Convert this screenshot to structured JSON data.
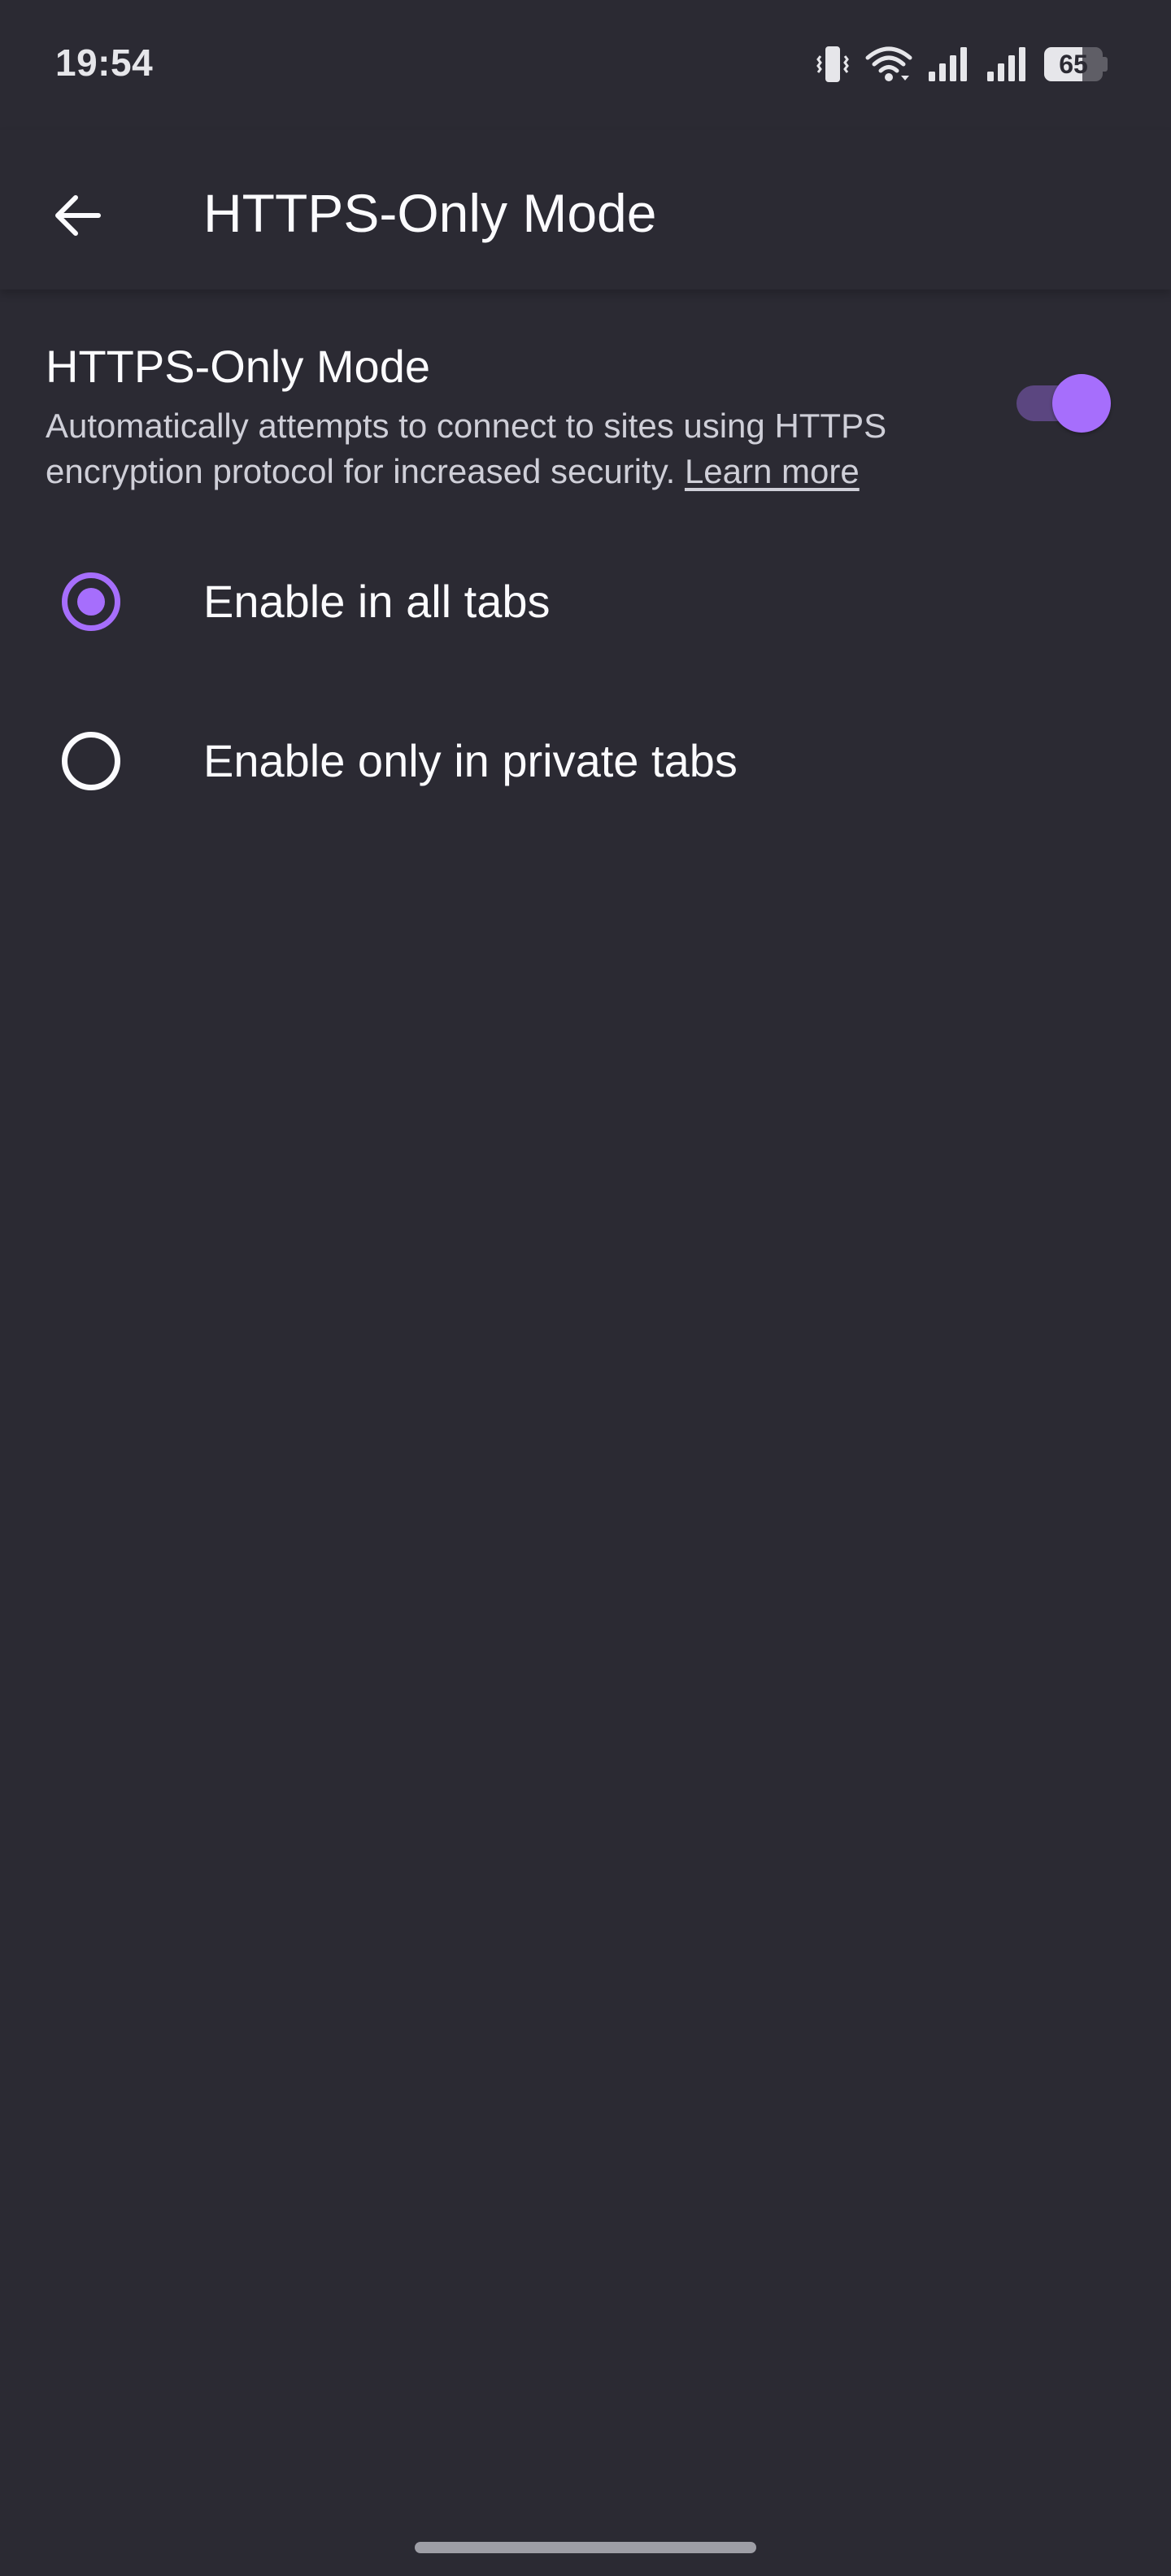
{
  "status_bar": {
    "time": "19:54",
    "battery_percent": "65",
    "battery_level": 0.65,
    "icons": [
      "vibrate-icon",
      "wifi-icon",
      "signal-icon",
      "signal-icon",
      "battery-icon"
    ]
  },
  "app_bar": {
    "back_icon": "arrow-back-icon",
    "title": "HTTPS-Only Mode"
  },
  "setting": {
    "title": "HTTPS-Only Mode",
    "summary": "Automatically attempts to connect to sites using HTTPS encryption protocol for increased security.",
    "learn_more": "Learn more",
    "enabled": true
  },
  "options": [
    {
      "label": "Enable in all tabs",
      "checked": true
    },
    {
      "label": "Enable only in private tabs",
      "checked": false
    }
  ],
  "colors": {
    "background": "#2b2a33",
    "accent": "#a66efc",
    "toggle_track": "#5b4680",
    "text_primary": "#fbfbfe",
    "text_secondary": "#cfcfd8"
  }
}
